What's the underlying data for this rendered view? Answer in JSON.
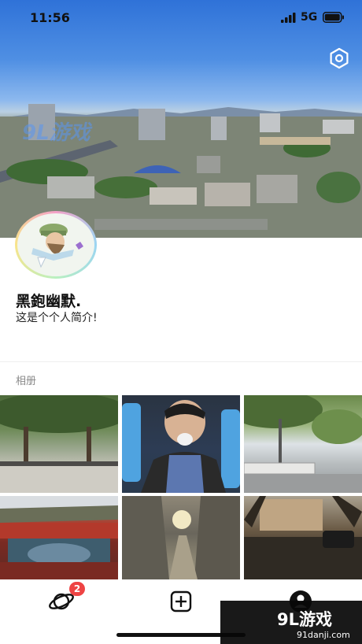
{
  "status_bar": {
    "time": "11:56",
    "network": "5G"
  },
  "cover": {
    "watermark": "9L游戏"
  },
  "profile": {
    "name": "黑鉋幽默.",
    "bio": "这是个个人简介!"
  },
  "album": {
    "label": "相册"
  },
  "tabbar": {
    "discover_badge": "2"
  },
  "watermark": {
    "logo": "9L游戏",
    "url": "91danji.com"
  },
  "colors": {
    "badge": "#ee4444",
    "sky": "#4f8fe3"
  }
}
